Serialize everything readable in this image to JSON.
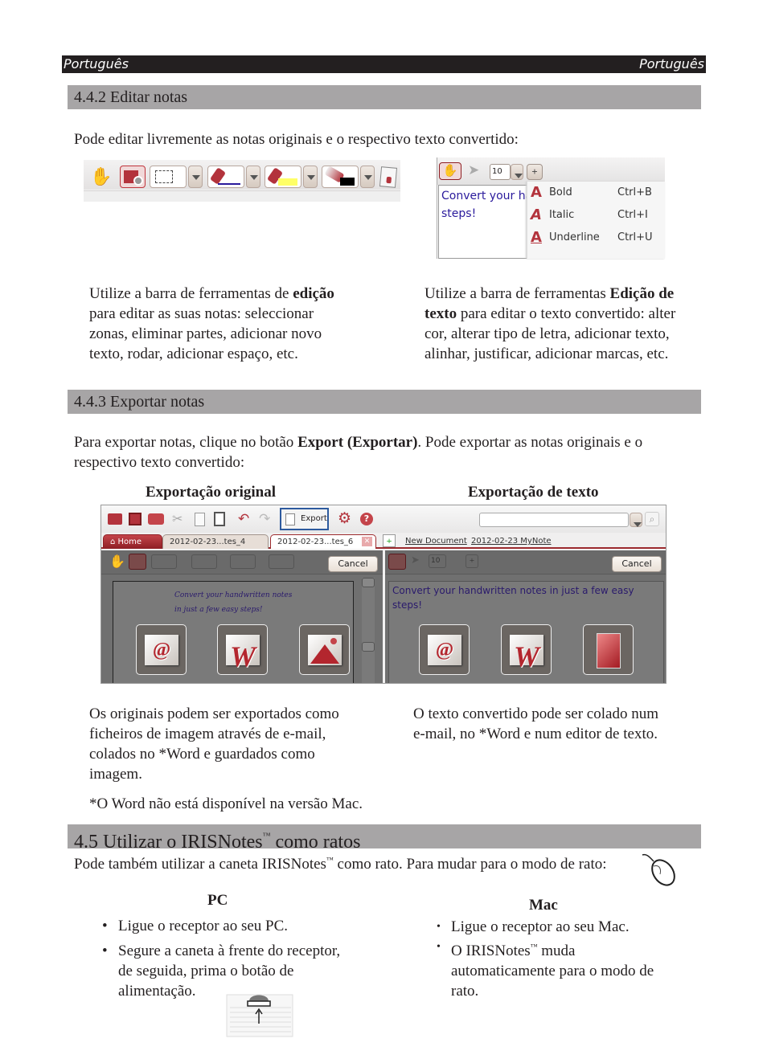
{
  "header": {
    "left_label": "Português",
    "right_label": "Português"
  },
  "sections": {
    "edit": {
      "title": "4.4.2 Editar notas",
      "intro": "Pode editar livremente as notas originais e o respectivo texto convertido:",
      "left_desc": {
        "pre": "Utilize a barra de ferramentas de ",
        "bold": "edição",
        "post": " para editar as suas notas: seleccionar zonas, eliminar partes, adicionar novo texto, rodar, adicionar espaço, etc."
      },
      "right_desc": {
        "pre": "Utilize a barra de ferramentas ",
        "bold": "Edição de texto",
        "post": " para editar o texto convertido: alter cor, alterar tipo de letra, adicionar texto, alinhar, justificar, adicionar marcas, etc."
      }
    },
    "export": {
      "title": "4.4.3 Exportar notas",
      "intro_pre": "Para exportar notas, clique no botão ",
      "intro_bold": "Export (Exportar)",
      "intro_post": ". Pode exportar as notas originais e o respectivo texto convertido:",
      "col_left_title": "Exportação original",
      "col_right_title": "Exportação de texto",
      "left_desc": "Os originais podem ser exportados como ficheiros de imagem através de e-mail, colados no *Word e guardados como imagem.",
      "right_desc": "O texto convertido pode ser colado num e-mail, no *Word e num editor de texto.",
      "footnote": "*O Word não está disponível na versão Mac."
    },
    "mouse": {
      "title_pre": "4.5 Utilizar o IRISNotes",
      "title_tm": "™",
      "title_post": " como ratos",
      "intro_pre": "Pode também utilizar a caneta IRISNotes",
      "intro_tm": "™",
      "intro_post": " como rato. Para mudar para o modo de rato:",
      "pc": {
        "title": "PC",
        "items": [
          "Ligue o receptor ao seu PC.",
          "Segure a caneta à frente do receptor, de seguida, prima o botão de alimentação."
        ]
      },
      "mac": {
        "title": "Mac",
        "item1": "Ligue o receptor ao seu Mac.",
        "item2_pre": "O IRISNotes",
        "item2_tm": "™",
        "item2_post": " muda automaticamente para o modo de rato."
      }
    }
  },
  "screens": {
    "text_toolbar": {
      "font_size": "10",
      "sample_text_line1": "Convert your ha",
      "sample_text_line2": "steps!",
      "menu": [
        {
          "icon": "A",
          "label": "Bold",
          "shortcut": "Ctrl+B"
        },
        {
          "icon": "A",
          "label": "Italic",
          "shortcut": "Ctrl+I"
        },
        {
          "icon": "A",
          "label": "Underline",
          "shortcut": "Ctrl+U"
        }
      ]
    },
    "export_app": {
      "export_label": "Export",
      "tabs": [
        "Home",
        "2012-02-23...tes_4",
        "2012-02-23...tes_6"
      ],
      "links": [
        "New Document",
        "2012-02-23  MyNote"
      ],
      "cancel_label": "Cancel",
      "font_size": "10",
      "handwriting_line1": "Convert your handwritten notes",
      "handwriting_line2": "in just a few easy steps!",
      "converted_text": "Convert your handwritten notes in just a few easy steps!",
      "left_tiles": [
        "email",
        "word",
        "image"
      ],
      "right_tiles": [
        "email",
        "word",
        "notepad"
      ]
    }
  }
}
